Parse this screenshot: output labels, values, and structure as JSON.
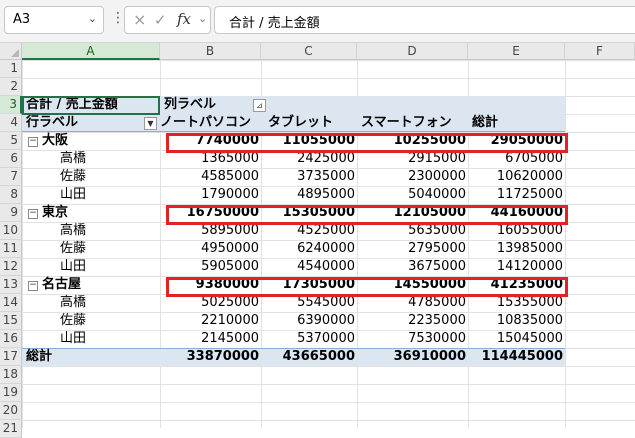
{
  "formula_bar": {
    "name_box": "A3",
    "cancel_icon": "×",
    "enter_icon": "✓",
    "fx_label": "fx",
    "formula": "合計 / 売上金額"
  },
  "columns": [
    "A",
    "B",
    "C",
    "D",
    "E",
    "F"
  ],
  "rows": [
    "1",
    "2",
    "3",
    "4",
    "5",
    "6",
    "7",
    "8",
    "9",
    "10",
    "11",
    "12",
    "13",
    "14",
    "15",
    "16",
    "17",
    "18",
    "19",
    "20",
    "21"
  ],
  "pivot": {
    "value_label": "合計 / 売上金額",
    "col_label": "列ラベル",
    "row_label": "行ラベル",
    "headers": [
      "ノートパソコン",
      "タブレット",
      "スマートフォン",
      "総計"
    ],
    "groups": [
      {
        "name": "大阪",
        "toggle": "⊟",
        "values": [
          "7740000",
          "11055000",
          "10255000",
          "29050000"
        ],
        "children": [
          {
            "name": "高橋",
            "values": [
              "1365000",
              "2425000",
              "2915000",
              "6705000"
            ]
          },
          {
            "name": "佐藤",
            "values": [
              "4585000",
              "3735000",
              "2300000",
              "10620000"
            ]
          },
          {
            "name": "山田",
            "values": [
              "1790000",
              "4895000",
              "5040000",
              "11725000"
            ]
          }
        ]
      },
      {
        "name": "東京",
        "toggle": "⊟",
        "values": [
          "16750000",
          "15305000",
          "12105000",
          "44160000"
        ],
        "children": [
          {
            "name": "高橋",
            "values": [
              "5895000",
              "4525000",
              "5635000",
              "16055000"
            ]
          },
          {
            "name": "佐藤",
            "values": [
              "4950000",
              "6240000",
              "2795000",
              "13985000"
            ]
          },
          {
            "name": "山田",
            "values": [
              "5905000",
              "4540000",
              "3675000",
              "14120000"
            ]
          }
        ]
      },
      {
        "name": "名古屋",
        "toggle": "⊟",
        "values": [
          "9380000",
          "17305000",
          "14550000",
          "41235000"
        ],
        "children": [
          {
            "name": "高橋",
            "values": [
              "5025000",
              "5545000",
              "4785000",
              "15355000"
            ]
          },
          {
            "name": "佐藤",
            "values": [
              "2210000",
              "6390000",
              "2235000",
              "10835000"
            ]
          },
          {
            "name": "山田",
            "values": [
              "2145000",
              "5370000",
              "7530000",
              "15045000"
            ]
          }
        ]
      }
    ],
    "grand_total": {
      "name": "総計",
      "values": [
        "33870000",
        "43665000",
        "36910000",
        "114445000"
      ]
    }
  },
  "colors": {
    "header_band": "#dce6f1",
    "highlight": "#e02424",
    "selection": "#217346"
  }
}
